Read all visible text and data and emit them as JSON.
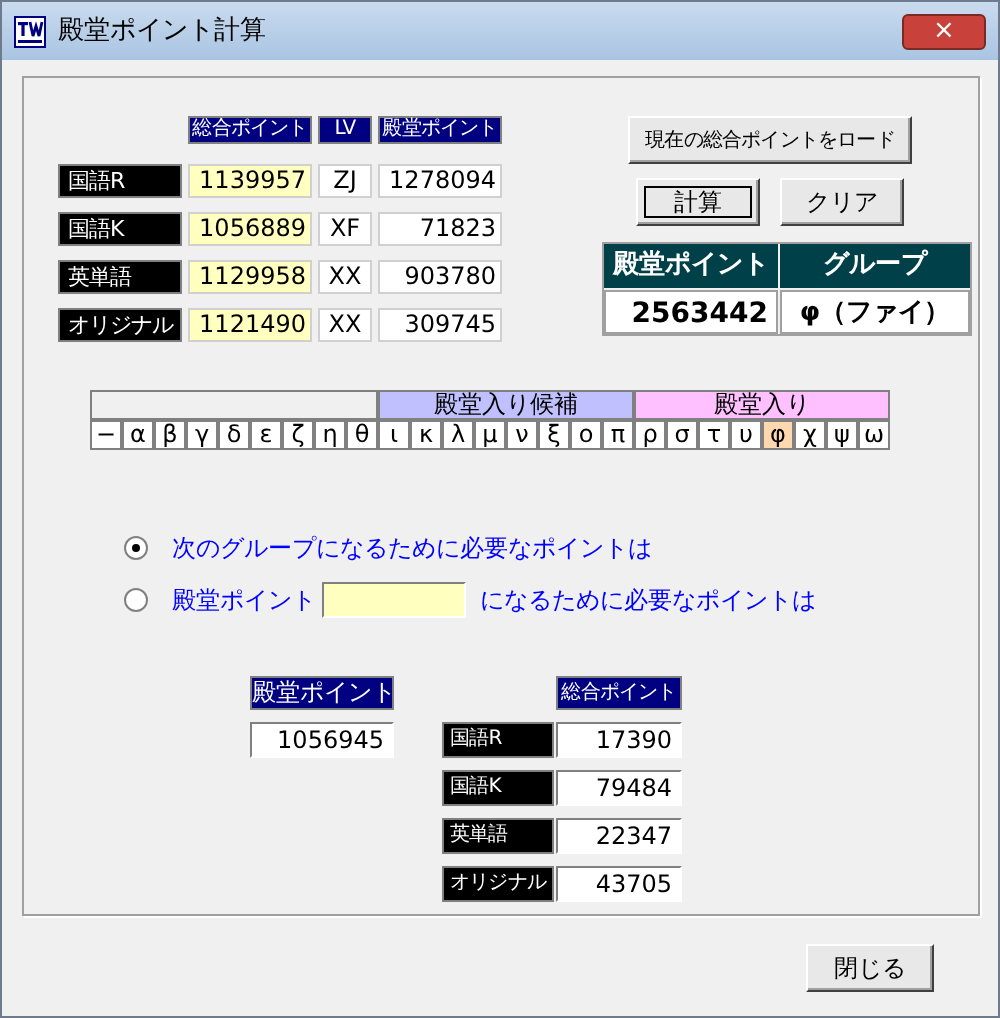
{
  "window": {
    "title": "殿堂ポイント計算",
    "close": "×"
  },
  "table": {
    "columns": [
      "総合ポイント",
      "LV",
      "殿堂ポイント"
    ],
    "rows": [
      {
        "label": "国語R",
        "total": "1139957",
        "lv": "ZJ",
        "hall": "1278094"
      },
      {
        "label": "国語K",
        "total": "1056889",
        "lv": "XF",
        "hall": "71823"
      },
      {
        "label": "英単語",
        "total": "1129958",
        "lv": "XX",
        "hall": "903780"
      },
      {
        "label": "オリジナル",
        "total": "1121490",
        "lv": "XX",
        "hall": "309745"
      }
    ]
  },
  "buttons": {
    "load": "現在の総合ポイントをロード",
    "calc": "計算",
    "clear": "クリア"
  },
  "result": {
    "hall_header": "殿堂ポイント",
    "group_header": "グループ",
    "hall": "2563442",
    "group": "φ（ファイ）"
  },
  "greek": {
    "groups": [
      {
        "cells": [
          {
            "symbol": "−",
            "selected": false
          },
          {
            "symbol": "α",
            "selected": false
          },
          {
            "symbol": "β",
            "selected": false
          },
          {
            "symbol": "γ",
            "selected": false
          },
          {
            "symbol": "δ",
            "selected": false
          },
          {
            "symbol": "ε",
            "selected": false
          },
          {
            "symbol": "ζ",
            "selected": false
          },
          {
            "symbol": "η",
            "selected": false
          },
          {
            "symbol": "θ",
            "selected": false
          }
        ]
      },
      {
        "label": "殿堂入り候補",
        "color": "#c0c0ff",
        "cells": [
          {
            "symbol": "ι",
            "selected": false
          },
          {
            "symbol": "κ",
            "selected": false
          },
          {
            "symbol": "λ",
            "selected": false
          },
          {
            "symbol": "μ",
            "selected": false
          },
          {
            "symbol": "ν",
            "selected": false
          },
          {
            "symbol": "ξ",
            "selected": false
          },
          {
            "symbol": "ο",
            "selected": false
          },
          {
            "symbol": "π",
            "selected": false
          }
        ]
      },
      {
        "label": "殿堂入り",
        "color": "#ffc0ff",
        "cells": [
          {
            "symbol": "ρ",
            "selected": false
          },
          {
            "symbol": "σ",
            "selected": false
          },
          {
            "symbol": "τ",
            "selected": false
          },
          {
            "symbol": "υ",
            "selected": false
          },
          {
            "symbol": "φ",
            "selected": true
          },
          {
            "symbol": "χ",
            "selected": false
          },
          {
            "symbol": "ψ",
            "selected": false
          },
          {
            "symbol": "ω",
            "selected": false
          }
        ]
      }
    ]
  },
  "options": [
    {
      "kind": "text",
      "selected": true,
      "label": "次のグループになるために必要なポイントは"
    },
    {
      "kind": "field",
      "selected": false,
      "label": "殿堂ポイント",
      "after": "になるために必要なポイントは"
    }
  ],
  "needed": {
    "hall_header": "殿堂ポイント",
    "hall": "1056945",
    "total_header": "総合ポイント",
    "rows": [
      {
        "label": "国語R",
        "value": "17390"
      },
      {
        "label": "国語K",
        "value": "79484"
      },
      {
        "label": "英単語",
        "value": "22347"
      },
      {
        "label": "オリジナル",
        "value": "43705"
      }
    ]
  },
  "close_button": "閉じる"
}
